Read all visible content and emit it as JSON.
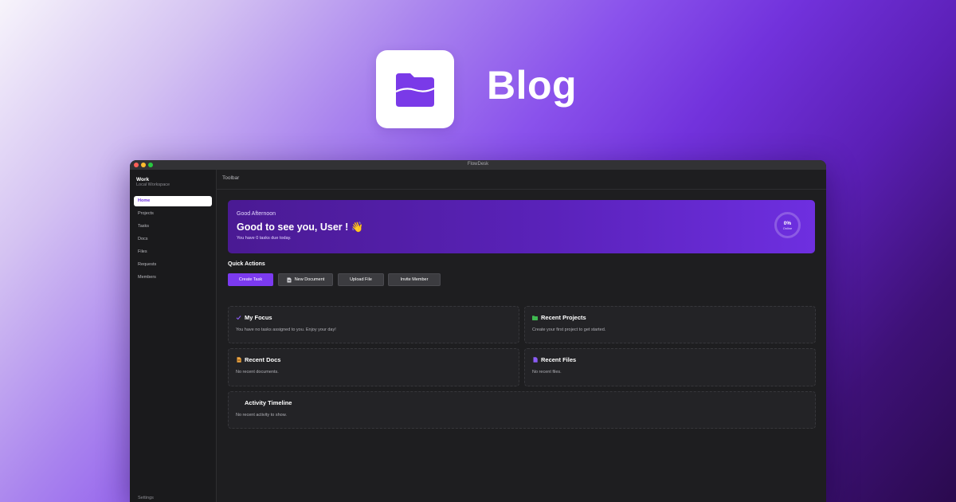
{
  "hero": {
    "title": "Blog"
  },
  "window": {
    "title": "FlowDesk"
  },
  "sidebar": {
    "workspace_name": "Work",
    "workspace_sub": "Local Workspace",
    "items": [
      {
        "label": "Home",
        "active": true
      },
      {
        "label": "Projects"
      },
      {
        "label": "Tasks"
      },
      {
        "label": "Docs"
      },
      {
        "label": "Files"
      },
      {
        "label": "Requests"
      },
      {
        "label": "Members"
      }
    ],
    "settings_label": "Settings"
  },
  "toolbar": {
    "label": "Toolbar"
  },
  "banner": {
    "greeting": "Good Afternoon",
    "headline": "Good to see you,  User ! 👋",
    "subtitle": "You have 0 tasks due today.",
    "ring_value": "0%",
    "ring_label": "Online"
  },
  "quick_actions": {
    "title": "Quick Actions",
    "buttons": [
      {
        "label": "Create Task"
      },
      {
        "label": "New Document"
      },
      {
        "label": "Upload File"
      },
      {
        "label": "Invite Member"
      }
    ]
  },
  "cards": {
    "my_focus": {
      "title": "My Focus",
      "text": "You have no tasks assigned to you. Enjoy your day!"
    },
    "recent_projects": {
      "title": "Recent Projects",
      "text": "Create your first project to get started."
    },
    "recent_docs": {
      "title": "Recent Docs",
      "text": "No recent documents."
    },
    "recent_files": {
      "title": "Recent Files",
      "text": "No recent files."
    },
    "activity": {
      "title": "Activity Timeline",
      "text": "No recent activity to show."
    }
  },
  "colors": {
    "accent": "#7b3af0",
    "banner_start": "#4a1a93",
    "banner_end": "#6e2fe0",
    "window_bg": "#1e1e20",
    "projects_icon": "#3fb950",
    "docs_icon": "#f0a640",
    "files_icon": "#8b5cf6"
  }
}
